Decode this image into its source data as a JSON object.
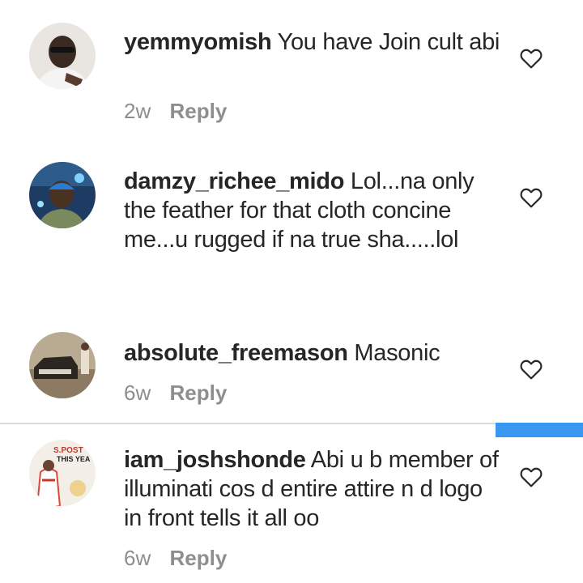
{
  "comments": [
    {
      "username": "yemmyomish",
      "text": " You have Join cult abi",
      "time": "2w",
      "reply_label": "Reply"
    },
    {
      "username": "damzy_richee_mido",
      "text": " Lol...na only the feather for that cloth concine me...u rugged if na true sha.....lol",
      "time": "",
      "reply_label": ""
    },
    {
      "username": "absolute_freemason",
      "text": " Masonic",
      "time": "6w",
      "reply_label": "Reply"
    },
    {
      "username": "iam_joshshonde",
      "text": " Abi u b member of illuminati cos d entire attire n d logo in front tells it all oo",
      "time": "6w",
      "reply_label": "Reply",
      "avatar_text": [
        "S.POST",
        "THIS YEA"
      ]
    }
  ],
  "icons": {
    "like": "heart-outline-icon"
  },
  "colors": {
    "text": "#262626",
    "muted": "#8e8e8e",
    "accent": "#3897f0",
    "divider": "#dbdbdb"
  }
}
